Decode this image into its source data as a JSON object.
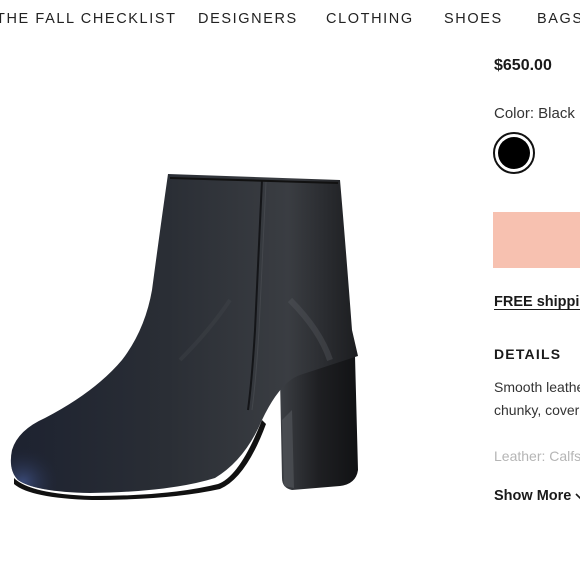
{
  "nav": {
    "items": [
      "THE FALL CHECKLIST",
      "DESIGNERS",
      "CLOTHING",
      "SHOES",
      "BAGS"
    ]
  },
  "product": {
    "price": "$650.00",
    "color_label": "Color: Black",
    "swatch_color": "#000000",
    "cta_color": "#f7c1b0",
    "shipping_text": "FREE shipping",
    "details_heading": "DETAILS",
    "description_lines": [
      "Smooth leather",
      "chunky, covered",
      "Leather: Calfskin"
    ],
    "show_more_label": "Show More"
  }
}
